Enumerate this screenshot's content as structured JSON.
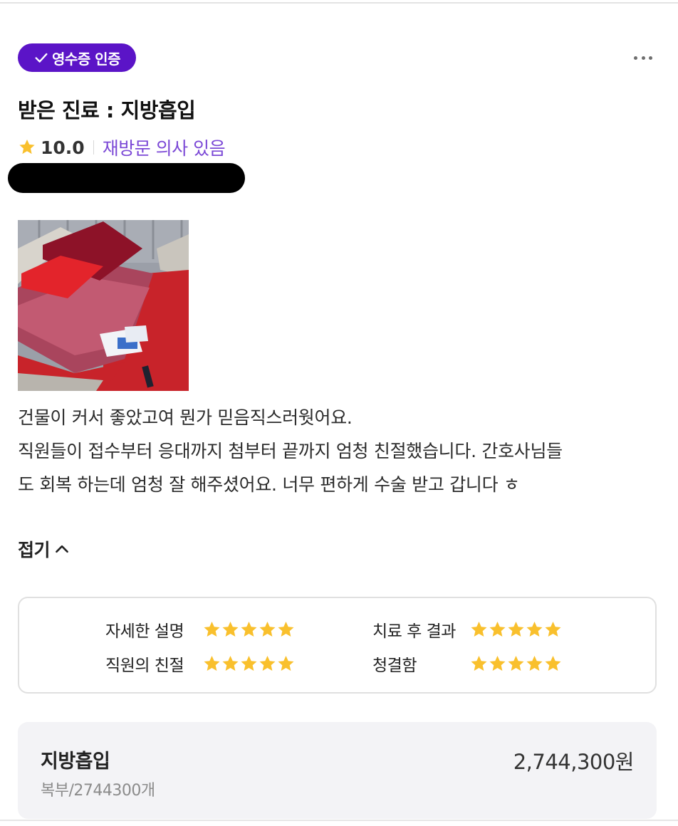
{
  "badge": {
    "label": "영수증 인증",
    "color": "#5b14c7"
  },
  "menu": {
    "icon": "more-horizontal-icon"
  },
  "title": "받은 진료 :  지방흡입",
  "rating": {
    "score": "10.0",
    "revisit_label": "재방문 의사 있음",
    "star_color": "#f9c02d",
    "revisit_color": "#7b48d6"
  },
  "photo": {
    "description_icon": "review-photo"
  },
  "review": {
    "line1": "건물이 커서 좋았고여 뭔가 믿음직스러웟어요.",
    "line2": "직원들이 접수부터 응대까지 첨부터 끝까지 엄청 친절했습니다. 간호사님들",
    "line3": "도 회복 하는데 엄청 잘 해주셨어요. 너무 편하게 수술 받고 갑니다 ㅎ"
  },
  "collapse": {
    "label": "접기"
  },
  "detail_ratings": [
    {
      "label": "자세한 설명",
      "stars": 5
    },
    {
      "label": "치료 후 결과",
      "stars": 5
    },
    {
      "label": "직원의 친절",
      "stars": 5
    },
    {
      "label": "청결함",
      "stars": 5
    }
  ],
  "price": {
    "name": "지방흡입",
    "detail": "복부/2744300개",
    "amount": "2,744,300원"
  }
}
